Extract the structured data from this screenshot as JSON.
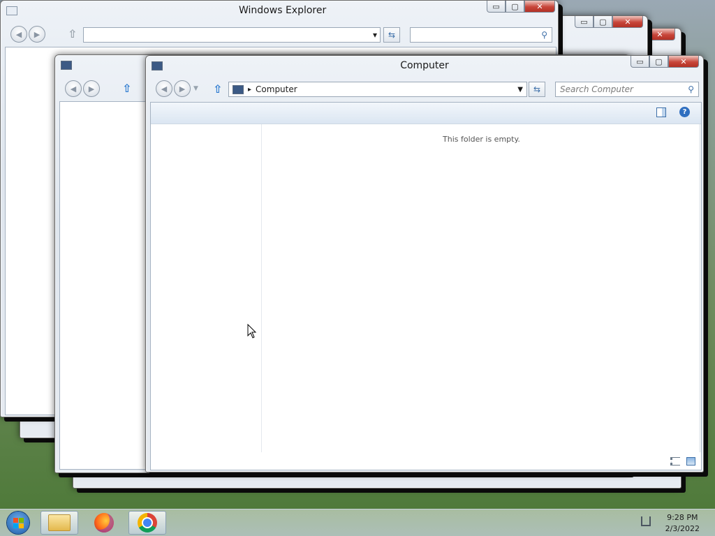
{
  "background_windows": {
    "explorer_title": "Windows Explorer",
    "caption_buttons": {
      "minimize": "▭",
      "maximize": "▢",
      "close": "✕"
    }
  },
  "front_window": {
    "title": "Computer",
    "breadcrumb": {
      "separator": "▸",
      "item": "Computer"
    },
    "search_placeholder": "Search Computer",
    "empty_message": "This folder is empty.",
    "caption_buttons": {
      "minimize": "▭",
      "maximize": "▢",
      "close": "✕"
    }
  },
  "icons": {
    "back": "back-icon",
    "forward": "forward-icon",
    "up": "up-arrow-icon",
    "refresh": "refresh-icon",
    "search": "search-icon",
    "preview_pane": "preview-pane-icon",
    "help": "help-icon",
    "details_view": "details-view-icon",
    "large_icons_view": "large-icons-view-icon"
  },
  "taskbar": {
    "items": [
      "start-button",
      "windows-explorer",
      "firefox",
      "chrome"
    ],
    "clock": {
      "time": "9:28 PM",
      "date": "2/3/2022"
    }
  },
  "colors": {
    "accent": "#2c7ad0",
    "close_red": "#c8463a",
    "window_frame": "#dfe6ee"
  }
}
